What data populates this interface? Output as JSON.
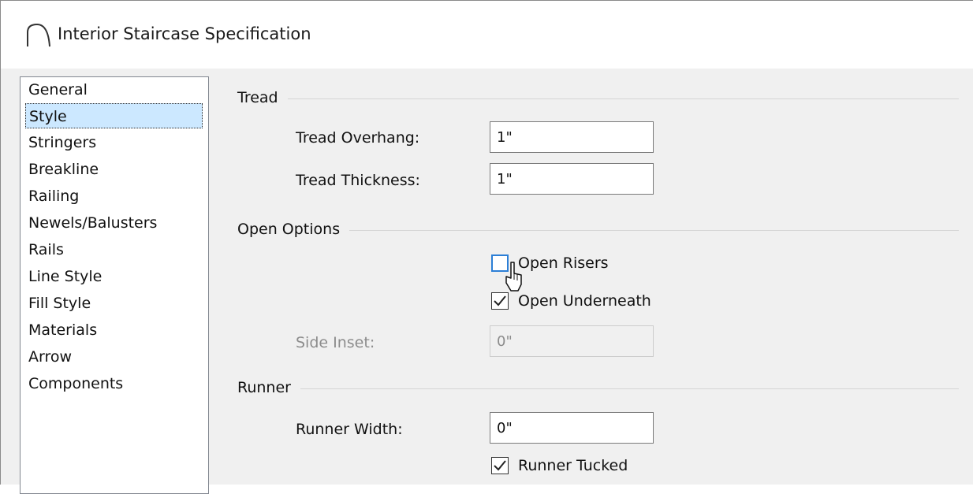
{
  "window": {
    "title": "Interior Staircase Specification",
    "icon": "arch-icon"
  },
  "nav": {
    "items": [
      {
        "label": "General",
        "selected": false
      },
      {
        "label": "Style",
        "selected": true
      },
      {
        "label": "Stringers",
        "selected": false
      },
      {
        "label": "Breakline",
        "selected": false
      },
      {
        "label": "Railing",
        "selected": false
      },
      {
        "label": "Newels/Balusters",
        "selected": false
      },
      {
        "label": "Rails",
        "selected": false
      },
      {
        "label": "Line Style",
        "selected": false
      },
      {
        "label": "Fill Style",
        "selected": false
      },
      {
        "label": "Materials",
        "selected": false
      },
      {
        "label": "Arrow",
        "selected": false
      },
      {
        "label": "Components",
        "selected": false
      }
    ]
  },
  "tread": {
    "group_label": "Tread",
    "overhang_label": "Tread Overhang:",
    "overhang_value": "1\"",
    "thickness_label": "Tread Thickness:",
    "thickness_value": "1\""
  },
  "open_options": {
    "group_label": "Open Options",
    "open_risers_label": "Open Risers",
    "open_risers_checked": false,
    "open_underneath_label": "Open Underneath",
    "open_underneath_checked": true,
    "side_inset_label": "Side Inset:",
    "side_inset_value": "0\""
  },
  "runner": {
    "group_label": "Runner",
    "width_label": "Runner Width:",
    "width_value": "0\"",
    "tucked_label": "Runner Tucked",
    "tucked_checked": true
  },
  "colors": {
    "selection": "#cce8ff",
    "checkbox_hover": "#2c7fd6",
    "disabled_text": "#8c8c8c"
  }
}
